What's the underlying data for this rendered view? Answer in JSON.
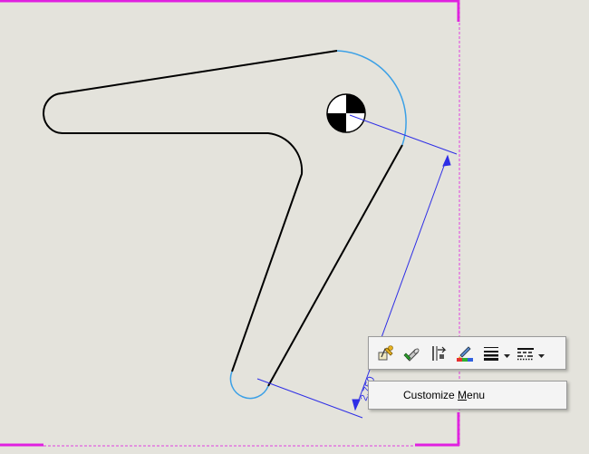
{
  "drawing": {
    "dimension_text": "2.750",
    "colors": {
      "background": "#e4e3dc",
      "sketch_line": "#000000",
      "selected_arc": "#3ba0e6",
      "dimension_line": "#2e2ee6",
      "sheet_border": "#e020e0",
      "sheet_dashed": "#e040e0"
    }
  },
  "context_toolbar": {
    "buttons": [
      {
        "name": "edit-sketch-icon"
      },
      {
        "name": "edit-feature-icon"
      },
      {
        "name": "rebuild-icon"
      },
      {
        "name": "appearance-icon"
      },
      {
        "name": "line-thickness-icon",
        "has_dropdown": true
      },
      {
        "name": "line-style-icon",
        "has_dropdown": true
      }
    ]
  },
  "context_menu": {
    "item_prefix": "Customize ",
    "item_mnemonic": "M",
    "item_suffix": "enu"
  }
}
